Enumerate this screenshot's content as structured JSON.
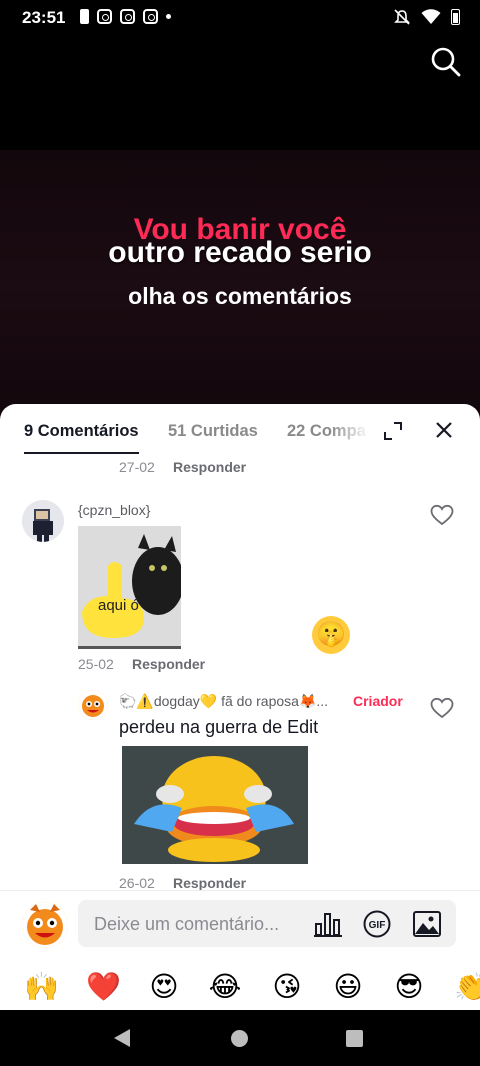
{
  "status_bar": {
    "time": "23:51"
  },
  "video": {
    "caption_top": "Vou banir você",
    "caption_main": "outro recado serio",
    "caption_sub": "olha os comentários"
  },
  "tabs": [
    {
      "label": "9 Comentários",
      "active": true
    },
    {
      "label": "51 Curtidas",
      "active": false
    },
    {
      "label": "22 Compa",
      "active": false
    }
  ],
  "comments": {
    "prev_date": "27-02",
    "reply_label": "Responder",
    "first": {
      "username": "{cpzn_blox}",
      "gif_text": "aqui ó",
      "date": "25-02"
    },
    "second": {
      "username": "🐑⚠️dogday💛 fã do  raposa🦊...",
      "badge": "Criador",
      "text": "perdeu na guerra de Edit",
      "date": "26-02"
    }
  },
  "composer": {
    "placeholder": "Deixe um comentário..."
  },
  "emoji_bar": [
    "🙌",
    "❤️",
    "😍",
    "😂",
    "😘",
    "😃",
    "😎",
    "👏"
  ],
  "colors": {
    "accent": "#fe2c55",
    "text": "#161823",
    "muted": "#8a8b91"
  }
}
